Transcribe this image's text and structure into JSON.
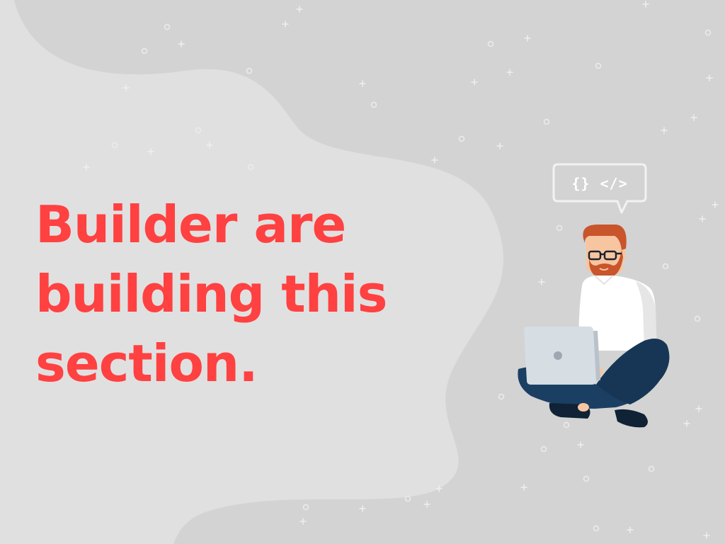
{
  "headline": {
    "line1": "Builder are",
    "line2": "building this",
    "line3": "section."
  },
  "code_bubble": {
    "braces": "{}",
    "tag": "</>"
  },
  "colors": {
    "background": "#d3d3d3",
    "blob": "#e0e0e0",
    "headline": "#ff4141",
    "sparkle": "#f2f2f2",
    "shirt": "#ffffff",
    "pants": "#1b3f63",
    "laptop": "#d6dde3",
    "hair": "#c8552b",
    "skin": "#f7c59f"
  },
  "illustration": {
    "name": "developer-with-laptop-illustration"
  }
}
